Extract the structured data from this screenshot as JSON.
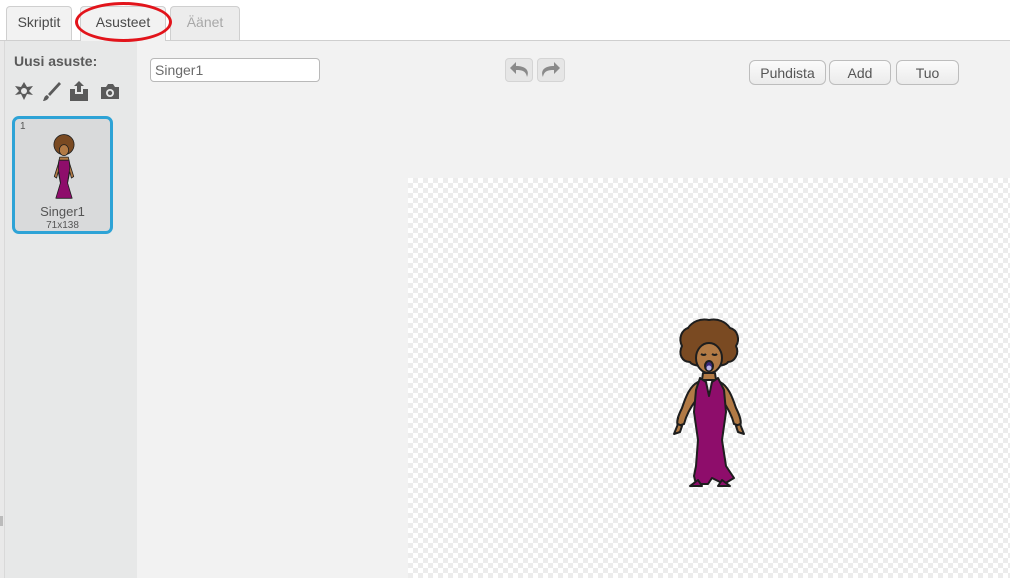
{
  "tabs": [
    {
      "label": "Skriptit",
      "active": false
    },
    {
      "label": "Asusteet",
      "active": true,
      "highlighted": true
    },
    {
      "label": "Äänet",
      "active": false,
      "disabled_look": true
    }
  ],
  "sidebar": {
    "new_costume_label": "Uusi asuste:",
    "tools": [
      "choose-from-library-icon",
      "paint-brush-icon",
      "upload-icon",
      "camera-icon"
    ],
    "costumes": [
      {
        "number": "1",
        "name": "Singer1",
        "size": "71x138",
        "selected": true
      }
    ]
  },
  "editor": {
    "costume_name_value": "Singer1",
    "undo_icon": "undo-icon",
    "redo_icon": "redo-icon",
    "clear_label": "Puhdista",
    "add_label": "Add",
    "import_label": "Tuo"
  },
  "colors": {
    "selection_blue": "#2ea3d6",
    "highlight_red": "#e2141b",
    "dress_magenta": "#8e0d6b",
    "hair_brown": "#7a4a22",
    "skin": "#b27a45"
  }
}
